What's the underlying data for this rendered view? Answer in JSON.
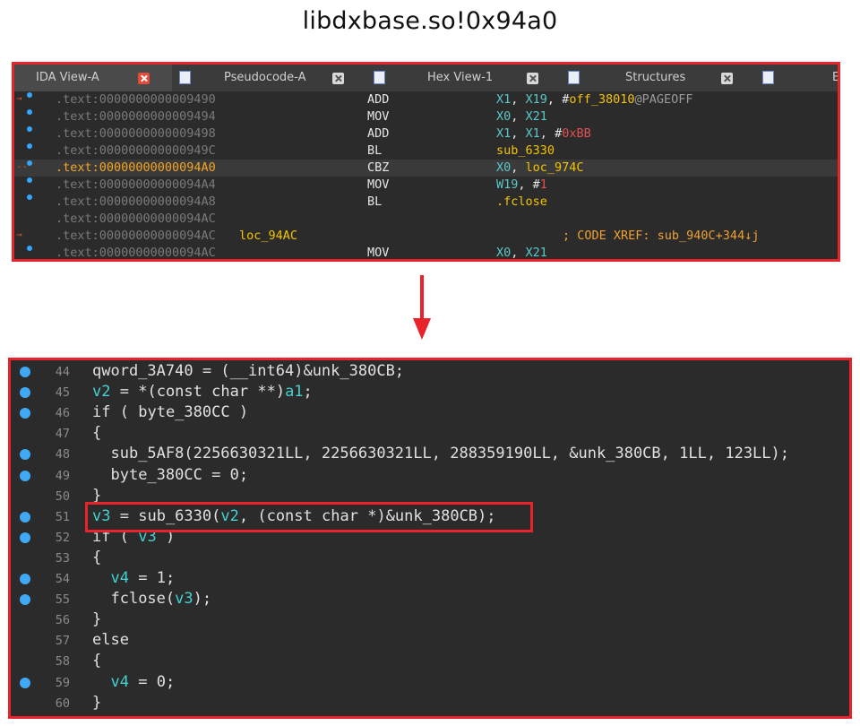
{
  "title": "libdxbase.so!0x94a0",
  "ida": {
    "tabs": [
      {
        "label": "IDA View-A",
        "active": true,
        "icon": "",
        "close": "red"
      },
      {
        "label": "Pseudocode-A",
        "active": false,
        "icon": "pseudocode-icon",
        "close": "grey"
      },
      {
        "label": "Hex View-1",
        "active": false,
        "icon": "hex-view-icon",
        "close": "grey"
      },
      {
        "label": "Structures",
        "active": false,
        "icon": "structures-icon",
        "close": "grey"
      },
      {
        "label": "E",
        "active": false,
        "icon": "enums-icon",
        "close": "none"
      }
    ],
    "rows": [
      {
        "addr": ".text:0000000000009490",
        "label": "",
        "mnem": "ADD",
        "ops": "X1, X19, #off_38010@PAGEOFF",
        "comment": "",
        "dot": true,
        "current": false
      },
      {
        "addr": ".text:0000000000009494",
        "label": "",
        "mnem": "MOV",
        "ops": "X0, X21",
        "comment": "",
        "dot": true,
        "current": false
      },
      {
        "addr": ".text:0000000000009498",
        "label": "",
        "mnem": "ADD",
        "ops": "X1, X1, #0xBB",
        "comment": "",
        "dot": true,
        "current": false
      },
      {
        "addr": ".text:000000000000949C",
        "label": "",
        "mnem": "BL",
        "ops": "sub_6330",
        "comment": "",
        "dot": true,
        "current": false
      },
      {
        "addr": ".text:00000000000094A0",
        "label": "",
        "mnem": "CBZ",
        "ops": "X0, loc_974C",
        "comment": "",
        "dot": true,
        "current": true
      },
      {
        "addr": ".text:00000000000094A4",
        "label": "",
        "mnem": "MOV",
        "ops": "W19, #1",
        "comment": "",
        "dot": true,
        "current": false
      },
      {
        "addr": ".text:00000000000094A8",
        "label": "",
        "mnem": "BL",
        "ops": ".fclose",
        "comment": "",
        "dot": true,
        "current": false
      },
      {
        "addr": ".text:00000000000094AC",
        "label": "",
        "mnem": "",
        "ops": "",
        "comment": "",
        "dot": false,
        "current": false
      },
      {
        "addr": ".text:00000000000094AC",
        "label": "loc_94AC",
        "mnem": "",
        "ops": "",
        "comment": "; CODE XREF: sub_940C+344↓j",
        "dot": false,
        "current": false
      },
      {
        "addr": ".text:00000000000094AC",
        "label": "",
        "mnem": "MOV",
        "ops": "X0, X21",
        "comment": "",
        "dot": true,
        "current": false
      }
    ]
  },
  "pseudocode": {
    "lines": [
      {
        "num": "44",
        "dot": true,
        "text": "qword_3A740 = (__int64)&unk_380CB;"
      },
      {
        "num": "45",
        "dot": true,
        "text": "v2 = *(const char **)a1;"
      },
      {
        "num": "46",
        "dot": true,
        "text": "if ( byte_380CC )"
      },
      {
        "num": "47",
        "dot": false,
        "text": "{"
      },
      {
        "num": "48",
        "dot": true,
        "text": "  sub_5AF8(2256630321LL, 2256630321LL, 288359190LL, &unk_380CB, 1LL, 123LL);"
      },
      {
        "num": "49",
        "dot": true,
        "text": "  byte_380CC = 0;"
      },
      {
        "num": "50",
        "dot": false,
        "text": "}"
      },
      {
        "num": "51",
        "dot": true,
        "text": "v3 = sub_6330(v2, (const char *)&unk_380CB);"
      },
      {
        "num": "52",
        "dot": true,
        "text": "if ( v3 )"
      },
      {
        "num": "53",
        "dot": false,
        "text": "{"
      },
      {
        "num": "54",
        "dot": true,
        "text": "  v4 = 1;"
      },
      {
        "num": "55",
        "dot": true,
        "text": "  fclose(v3);"
      },
      {
        "num": "56",
        "dot": false,
        "text": "}"
      },
      {
        "num": "57",
        "dot": false,
        "text": "else"
      },
      {
        "num": "58",
        "dot": false,
        "text": "{"
      },
      {
        "num": "59",
        "dot": true,
        "text": "  v4 = 0;"
      },
      {
        "num": "60",
        "dot": false,
        "text": "}"
      }
    ],
    "highlight_line": "51"
  },
  "colors": {
    "accent": "#e8232a",
    "bg": "#2b2b2b",
    "address": "#7a7a7a",
    "current_address": "#f5a623",
    "register": "#5bc8c8",
    "label": "#f5c400",
    "breakpoint": "#3fa9f5"
  }
}
